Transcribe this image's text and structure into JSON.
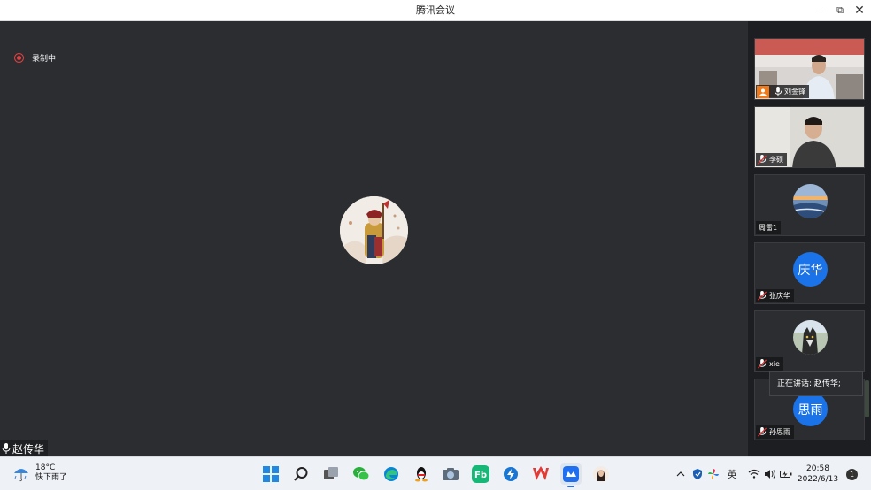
{
  "window": {
    "title": "腾讯会议"
  },
  "recording": {
    "label": "录制中"
  },
  "speaker": {
    "name": "赵传华"
  },
  "participants": [
    {
      "name": "刘金锋"
    },
    {
      "name": "李硕"
    },
    {
      "name": "周雷1"
    },
    {
      "name": "张庆华",
      "avatar_text": "庆华"
    },
    {
      "name": "xie"
    },
    {
      "name": "孙思雨",
      "avatar_text": "思雨"
    }
  ],
  "speaking_tooltip": "正在讲话: 赵传华;",
  "taskbar": {
    "weather_temp": "18°C",
    "weather_desc": "快下雨了",
    "ime": "英",
    "time": "20:58",
    "date": "2022/6/13",
    "notifications": "1"
  },
  "colors": {
    "accent": "#1a73e8",
    "recording": "#e04040",
    "stage": "#2b2d31"
  }
}
